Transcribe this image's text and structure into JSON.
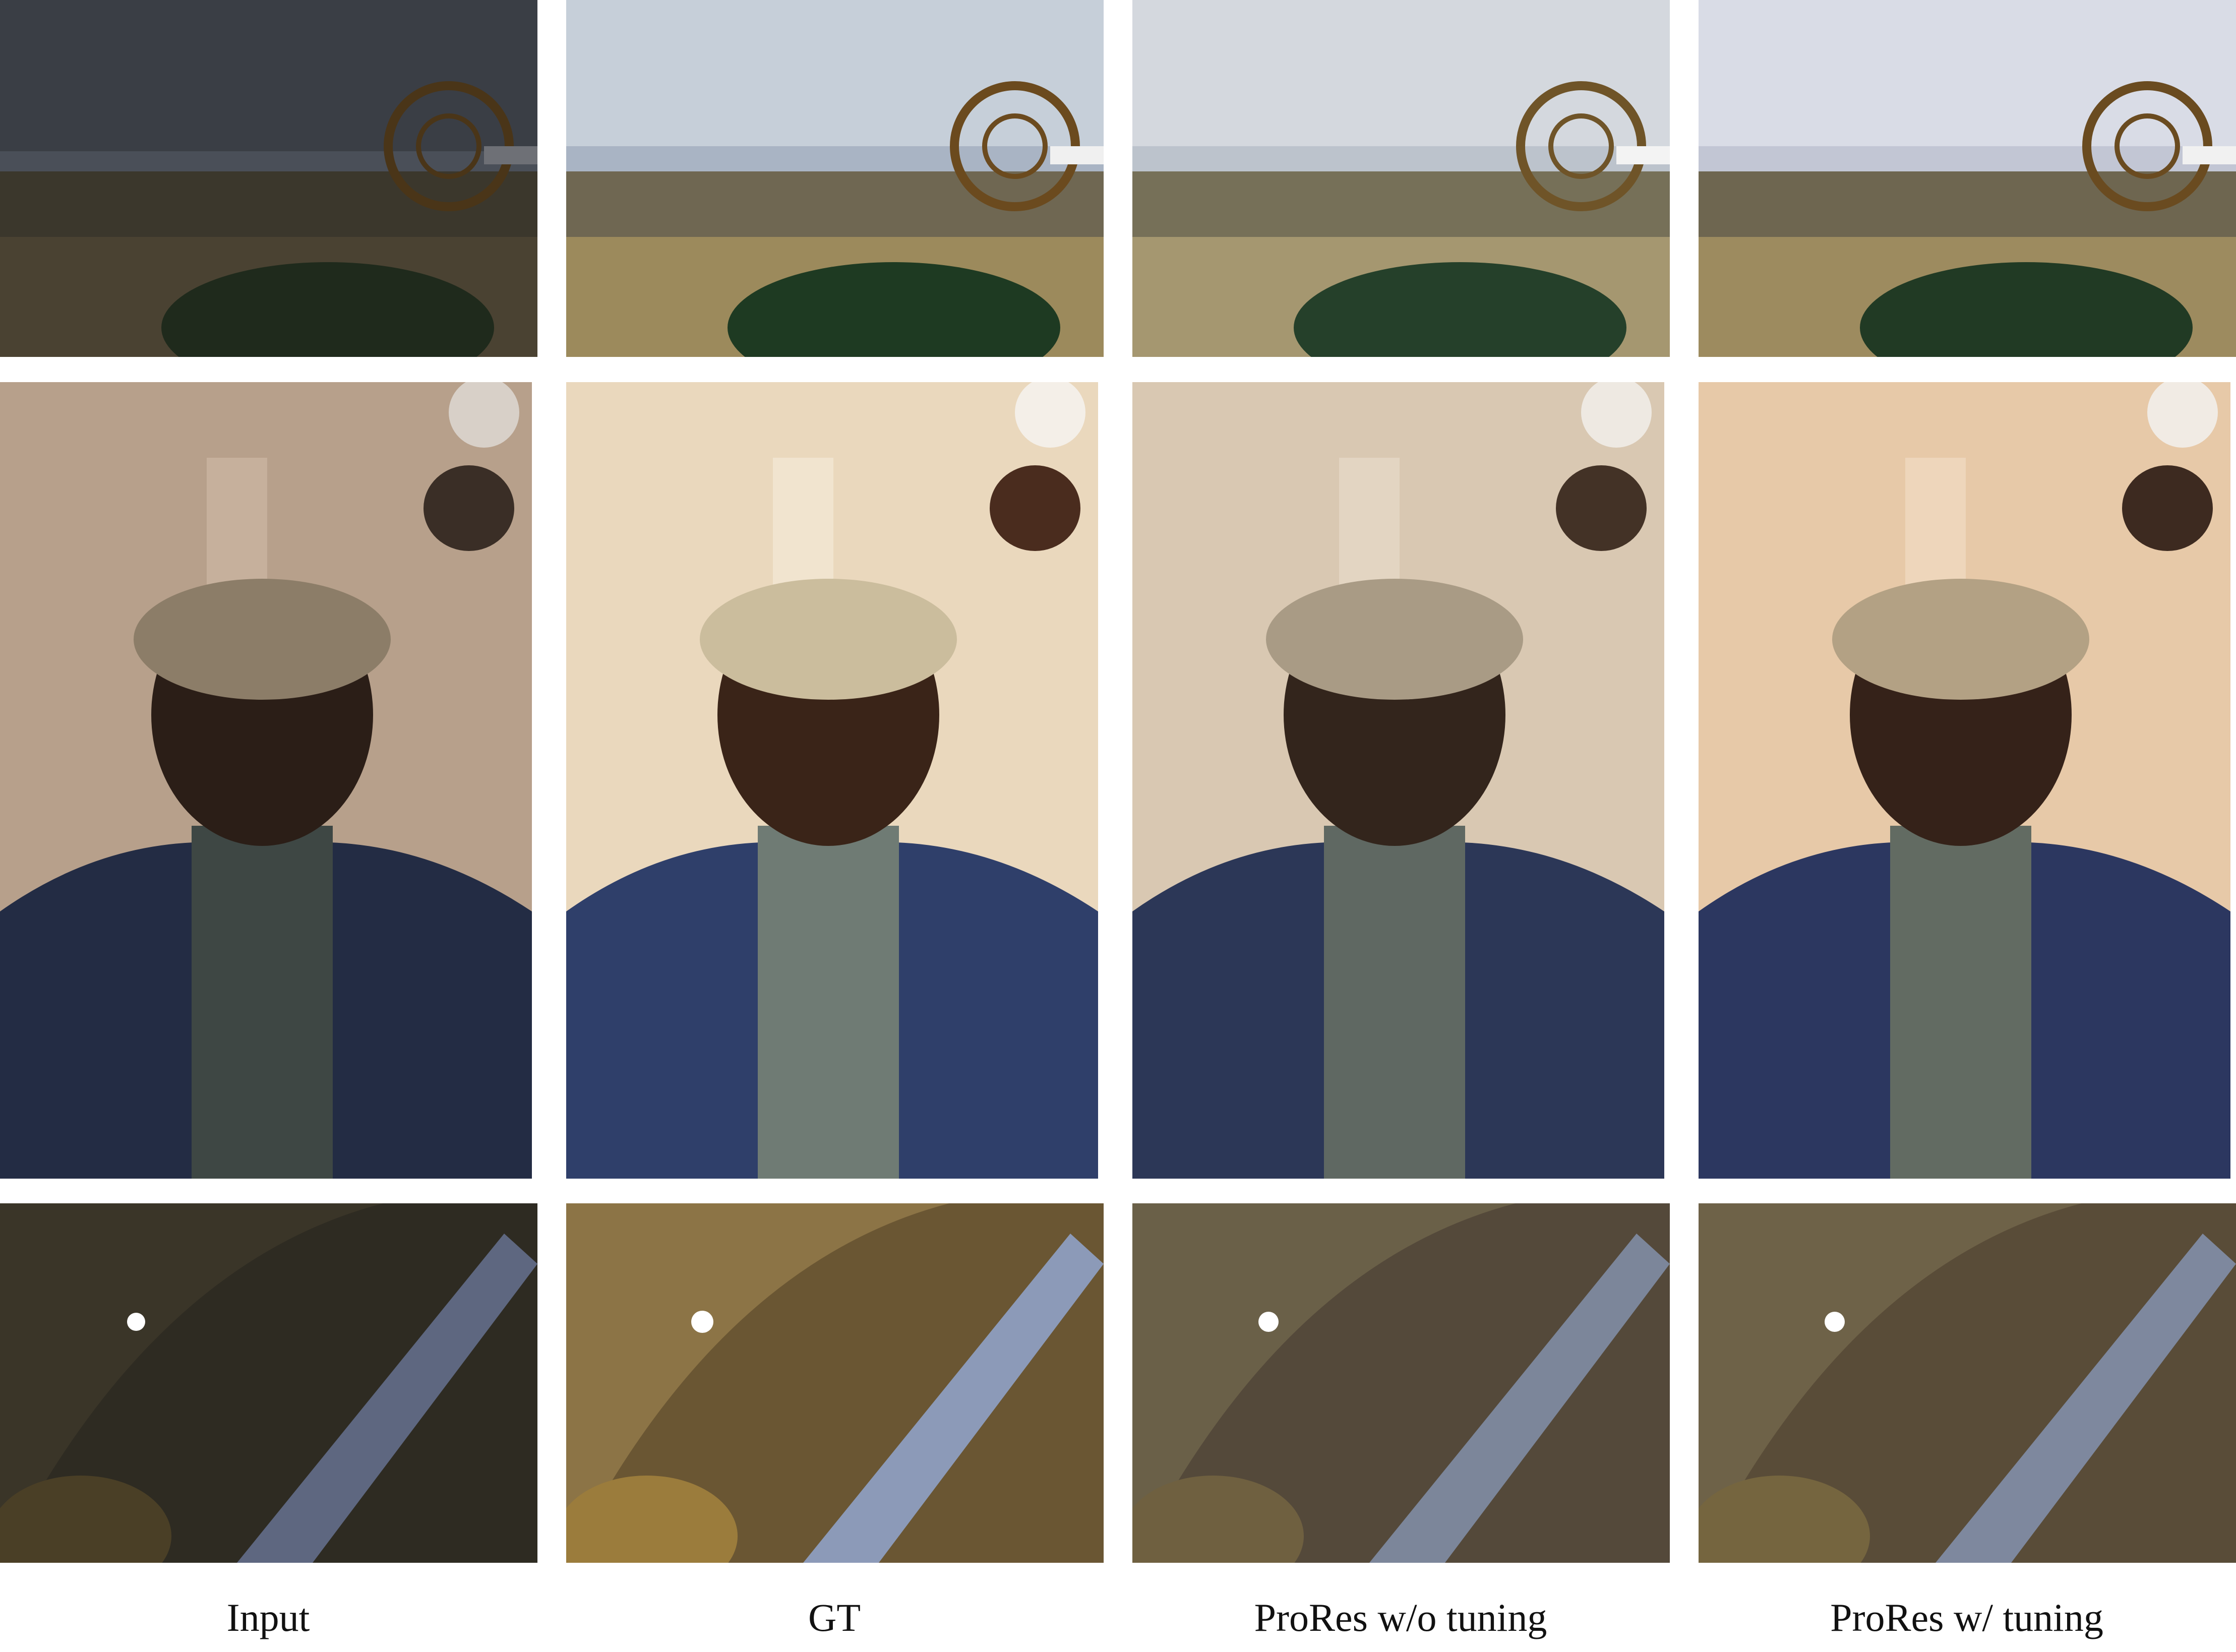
{
  "columns": [
    {
      "label": "Input",
      "variant": "input"
    },
    {
      "label": "GT",
      "variant": "gt"
    },
    {
      "label": "ProRes w/o tuning",
      "variant": "no_tuning"
    },
    {
      "label": "ProRes w/ tuning",
      "variant": "tuning"
    }
  ],
  "rows": [
    {
      "scene": "landscape-with-cable-reel"
    },
    {
      "scene": "portrait-man-in-cap-and-denim-jacket"
    },
    {
      "scene": "ornate-dome-ceiling"
    }
  ],
  "colors": {
    "background": "#ffffff",
    "label_text": "#111111"
  }
}
